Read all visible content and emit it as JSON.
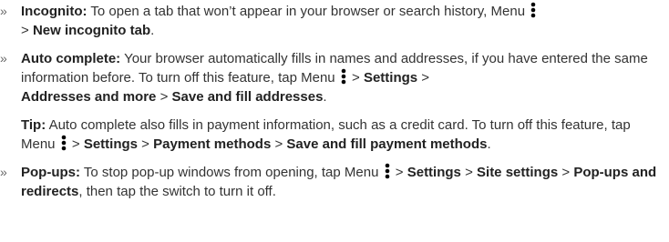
{
  "bullet_glyph": "»",
  "sep": ">",
  "incognito": {
    "label": "Incognito:",
    "text": "To open a tab that won’t appear in your browser or search history, Menu",
    "path1": "New incognito tab",
    "end": "."
  },
  "autocomplete": {
    "label": "Auto complete:",
    "text": "Your browser automatically fills in names and addresses, if you have entered the same information before. To turn off this feature, tap Menu",
    "path1": "Settings",
    "path2": "Addresses and more",
    "path3": "Save and fill addresses",
    "end": "."
  },
  "tip": {
    "label": "Tip:",
    "text": "Auto complete also fills in payment information, such as a credit card. To turn off this feature, tap Menu",
    "path1": "Settings",
    "path2": "Payment methods",
    "path3": "Save and fill payment methods",
    "end": "."
  },
  "popups": {
    "label": "Pop-ups:",
    "text": "To stop pop-up windows from opening, tap Menu",
    "path1": "Settings",
    "path2": "Site settings",
    "path3": "Pop-ups and redirects",
    "end": ", then tap the switch to turn it off."
  },
  "icon_name": "more-vert-icon",
  "colors": {
    "text": "#333333",
    "bold": "#222222",
    "icon": "#000000"
  }
}
